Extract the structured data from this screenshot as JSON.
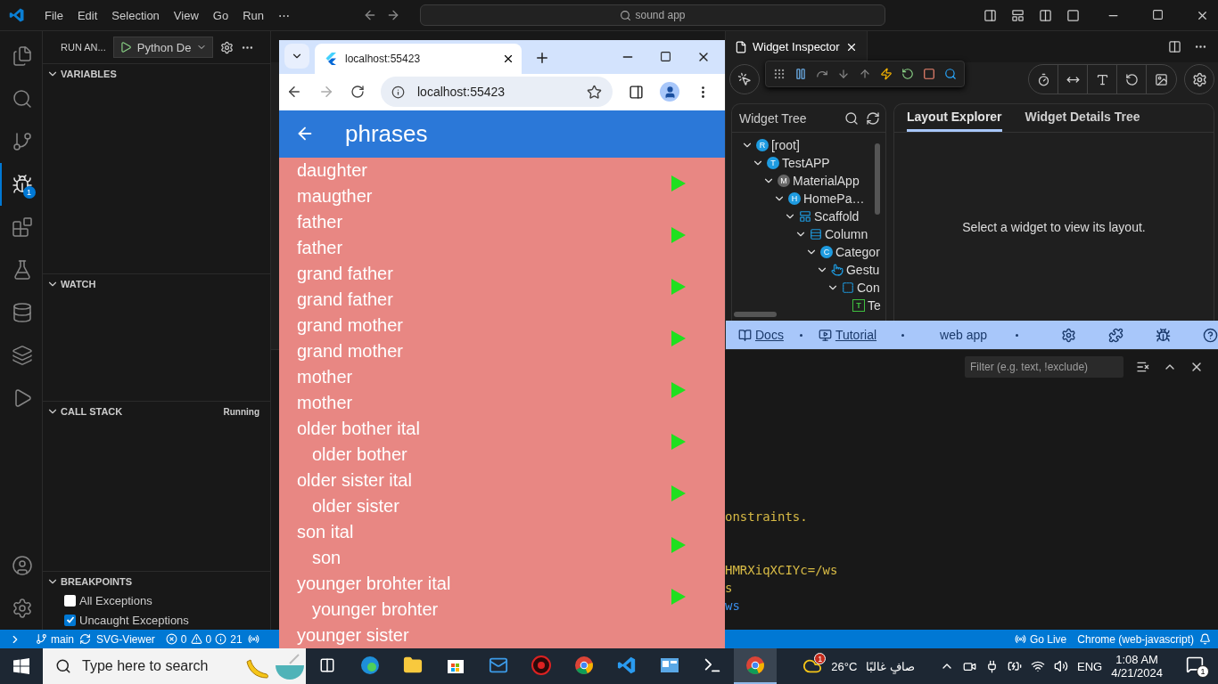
{
  "titlebar": {
    "menus": [
      "File",
      "Edit",
      "Selection",
      "View",
      "Go",
      "Run",
      "⋯"
    ],
    "search": "sound app"
  },
  "activity_bar": [
    {
      "selected": false
    },
    {
      "selected": false
    },
    {
      "selected": false
    },
    {
      "selected": true,
      "badge": "1"
    },
    {
      "selected": false
    },
    {
      "selected": false
    },
    {
      "selected": false
    },
    {
      "selected": false
    },
    {
      "selected": false
    }
  ],
  "run_debug": {
    "title": "RUN AN...",
    "config": "Python De",
    "sections": [
      {
        "title": "VARIABLES",
        "expanded": true
      },
      {
        "title": "WATCH",
        "expanded": true
      },
      {
        "title": "CALL STACK",
        "expanded": true,
        "status": "Running"
      },
      {
        "title": "BREAKPOINTS",
        "expanded": true,
        "items": [
          {
            "label": "All Exceptions",
            "checked": false
          },
          {
            "label": "Uncaught Exceptions",
            "checked": true
          }
        ]
      }
    ]
  },
  "inspector": {
    "tab": "Widget Inspector",
    "tree_title": "Widget Tree",
    "tree": [
      {
        "label": "[root]",
        "kind": "circle",
        "badge": "R",
        "expanded": true,
        "children": [
          {
            "label": "TestAPP",
            "kind": "circle",
            "badge": "T",
            "expanded": true,
            "children": [
              {
                "label": "MaterialApp",
                "kind": "material",
                "badge": "M",
                "expanded": true,
                "children": [
                  {
                    "label": "HomePa…",
                    "kind": "circle",
                    "badge": "H",
                    "expanded": true,
                    "children": [
                      {
                        "label": "Scaffold",
                        "kind": "scaffold",
                        "expanded": true,
                        "children": [
                          {
                            "label": "Column",
                            "kind": "column",
                            "expanded": true,
                            "children": [
                              {
                                "label": "Categor",
                                "kind": "circle",
                                "badge": "C",
                                "expanded": true,
                                "children": [
                                  {
                                    "label": "Gestu",
                                    "kind": "gesture",
                                    "expanded": true,
                                    "children": [
                                      {
                                        "label": "Con",
                                        "kind": "container",
                                        "expanded": true,
                                        "children": [
                                          {
                                            "label": "Te",
                                            "kind": "text",
                                            "badge": "T"
                                          }
                                        ]
                                      }
                                    ]
                                  }
                                ]
                              }
                            ]
                          }
                        ]
                      }
                    ]
                  }
                ]
              }
            ]
          }
        ]
      }
    ],
    "tabs": [
      {
        "label": "Layout Explorer",
        "selected": true
      },
      {
        "label": "Widget Details Tree",
        "selected": false
      }
    ],
    "message": "Select a widget to view its layout.",
    "footer": {
      "links": [
        "Docs",
        "Tutorial"
      ],
      "device": "web app"
    }
  },
  "panel": {
    "filter_placeholder": "Filter (e.g. text, !exclude)",
    "lines": [
      {
        "text": "onstraints.",
        "color": "#d7ba45"
      },
      {
        "text": "HMRXiqXCIYc=/ws",
        "color": "#d7ba45"
      },
      {
        "text": "s",
        "color": "#d7ba45"
      },
      {
        "text": "ws",
        "color": "#3b8eea"
      }
    ]
  },
  "status_bar": {
    "branch": "main",
    "extension": "SVG-Viewer",
    "errors": "0",
    "warnings": "0",
    "infos": "21",
    "go_live": "Go Live",
    "debug_target": "Chrome (web-javascript)"
  },
  "browser": {
    "tab_title": "localhost:55423",
    "url": "localhost:55423",
    "app_title": "phrases",
    "groups": [
      {
        "phrases": [
          {
            "text": "daughter",
            "indented": false
          },
          {
            "text": "maugther",
            "indented": false
          }
        ]
      },
      {
        "phrases": [
          {
            "text": "father",
            "indented": false
          },
          {
            "text": "father",
            "indented": false
          }
        ]
      },
      {
        "phrases": [
          {
            "text": "grand father",
            "indented": false
          },
          {
            "text": "grand father",
            "indented": false
          }
        ]
      },
      {
        "phrases": [
          {
            "text": "grand mother",
            "indented": false
          },
          {
            "text": "grand mother",
            "indented": false
          }
        ]
      },
      {
        "phrases": [
          {
            "text": "mother",
            "indented": false
          },
          {
            "text": "mother",
            "indented": false
          }
        ]
      },
      {
        "phrases": [
          {
            "text": "older bother ital",
            "indented": false
          },
          {
            "text": "older bother",
            "indented": true
          }
        ]
      },
      {
        "phrases": [
          {
            "text": "older sister ital",
            "indented": false
          },
          {
            "text": "older sister",
            "indented": true
          }
        ]
      },
      {
        "phrases": [
          {
            "text": "son ital",
            "indented": false
          },
          {
            "text": "son",
            "indented": true
          }
        ]
      },
      {
        "phrases": [
          {
            "text": "younger brohter ital",
            "indented": false
          },
          {
            "text": "younger brohter",
            "indented": true
          }
        ]
      },
      {
        "phrases": [
          {
            "text": "younger sister",
            "indented": false
          }
        ]
      }
    ]
  },
  "taskbar": {
    "search_placeholder": "Type here to search",
    "weather_badge": "1",
    "temperature": "26°C",
    "weather_text": "صافٍ غالبًا",
    "language": "ENG",
    "time": "1:08 AM",
    "date": "4/21/2024",
    "notifications": "1"
  }
}
